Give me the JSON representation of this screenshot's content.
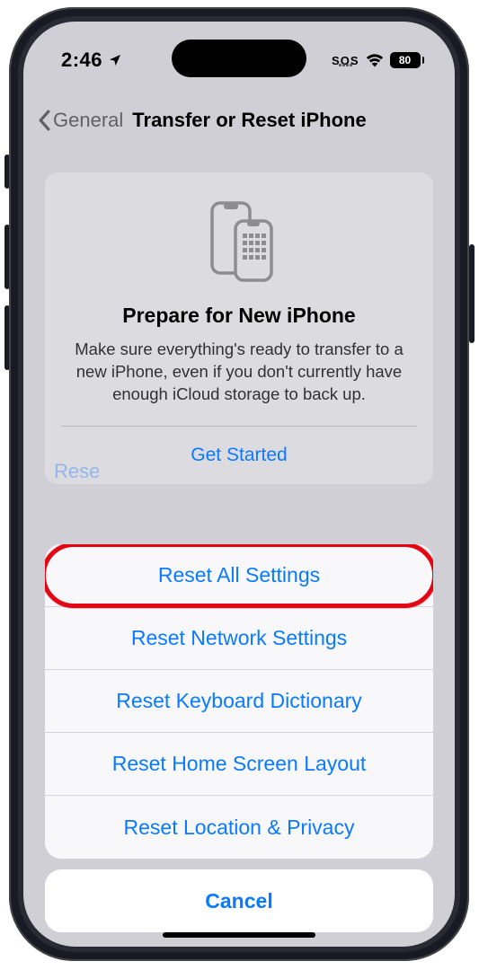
{
  "status": {
    "time": "2:46",
    "sos": "SOS",
    "battery_pct": "80"
  },
  "nav": {
    "back_label": "General",
    "title": "Transfer or Reset iPhone"
  },
  "prepare_card": {
    "title": "Prepare for New iPhone",
    "description": "Make sure everything's ready to transfer to a new iPhone, even if you don't currently have enough iCloud storage to back up.",
    "action": "Get Started"
  },
  "peek": {
    "reset": "Reset"
  },
  "sheet": {
    "items": [
      "Reset All Settings",
      "Reset Network Settings",
      "Reset Keyboard Dictionary",
      "Reset Home Screen Layout",
      "Reset Location & Privacy"
    ],
    "cancel": "Cancel"
  }
}
